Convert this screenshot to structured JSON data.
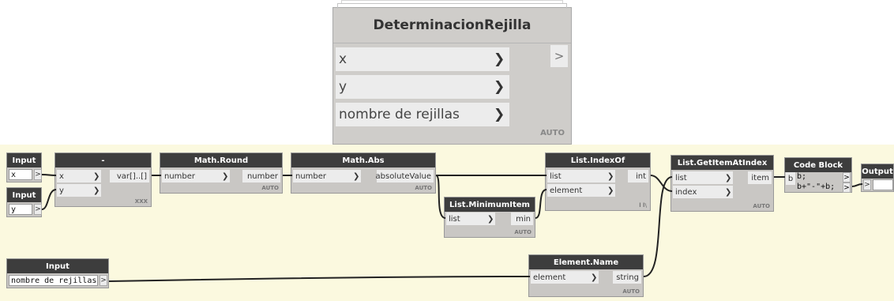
{
  "custom_node": {
    "title": "DeterminacionRejilla",
    "inputs": [
      "x",
      "y",
      "nombre de rejillas"
    ],
    "output": ">",
    "lacing": "AUTO"
  },
  "nodes": {
    "input_x": {
      "title": "Input",
      "value": "x",
      "out": ">"
    },
    "input_y": {
      "title": "Input",
      "value": "y",
      "out": ">"
    },
    "minus": {
      "title": "-",
      "inputs": [
        "x",
        "y"
      ],
      "output": "var[]..[]",
      "lacing": "XXX"
    },
    "math_round": {
      "title": "Math.Round",
      "input": "number",
      "output": "number",
      "lacing": "AUTO"
    },
    "math_abs": {
      "title": "Math.Abs",
      "input": "number",
      "output": "absoluteValue",
      "lacing": "AUTO"
    },
    "list_min": {
      "title": "List.MinimumItem",
      "input": "list",
      "output": "min",
      "lacing": "AUTO"
    },
    "list_indexof": {
      "title": "List.IndexOf",
      "inputs": [
        "list",
        "element"
      ],
      "output": "int",
      "lacing": "l l\\"
    },
    "list_getitem": {
      "title": "List.GetItemAtIndex",
      "inputs": [
        "list",
        "index"
      ],
      "output": "item",
      "lacing": "AUTO"
    },
    "code_block": {
      "title": "Code Block",
      "input": "b",
      "lines": [
        "b;",
        "b+\"-\"+b;"
      ],
      "outs": [
        ">",
        ">"
      ]
    },
    "output": {
      "title": "Output",
      "in": ">"
    },
    "input_nombre": {
      "title": "Input",
      "value": "nombre de rejillas",
      "out": ">"
    },
    "element_name": {
      "title": "Element.Name",
      "input": "element",
      "output": "string",
      "lacing": "AUTO"
    }
  },
  "icons": {
    "port_arrow": "chevron-right-icon"
  },
  "colors": {
    "canvas": "#fbf9df",
    "node_header": "#3d3d3d",
    "node_body": "#c9c7c4",
    "wire": "#222222"
  }
}
